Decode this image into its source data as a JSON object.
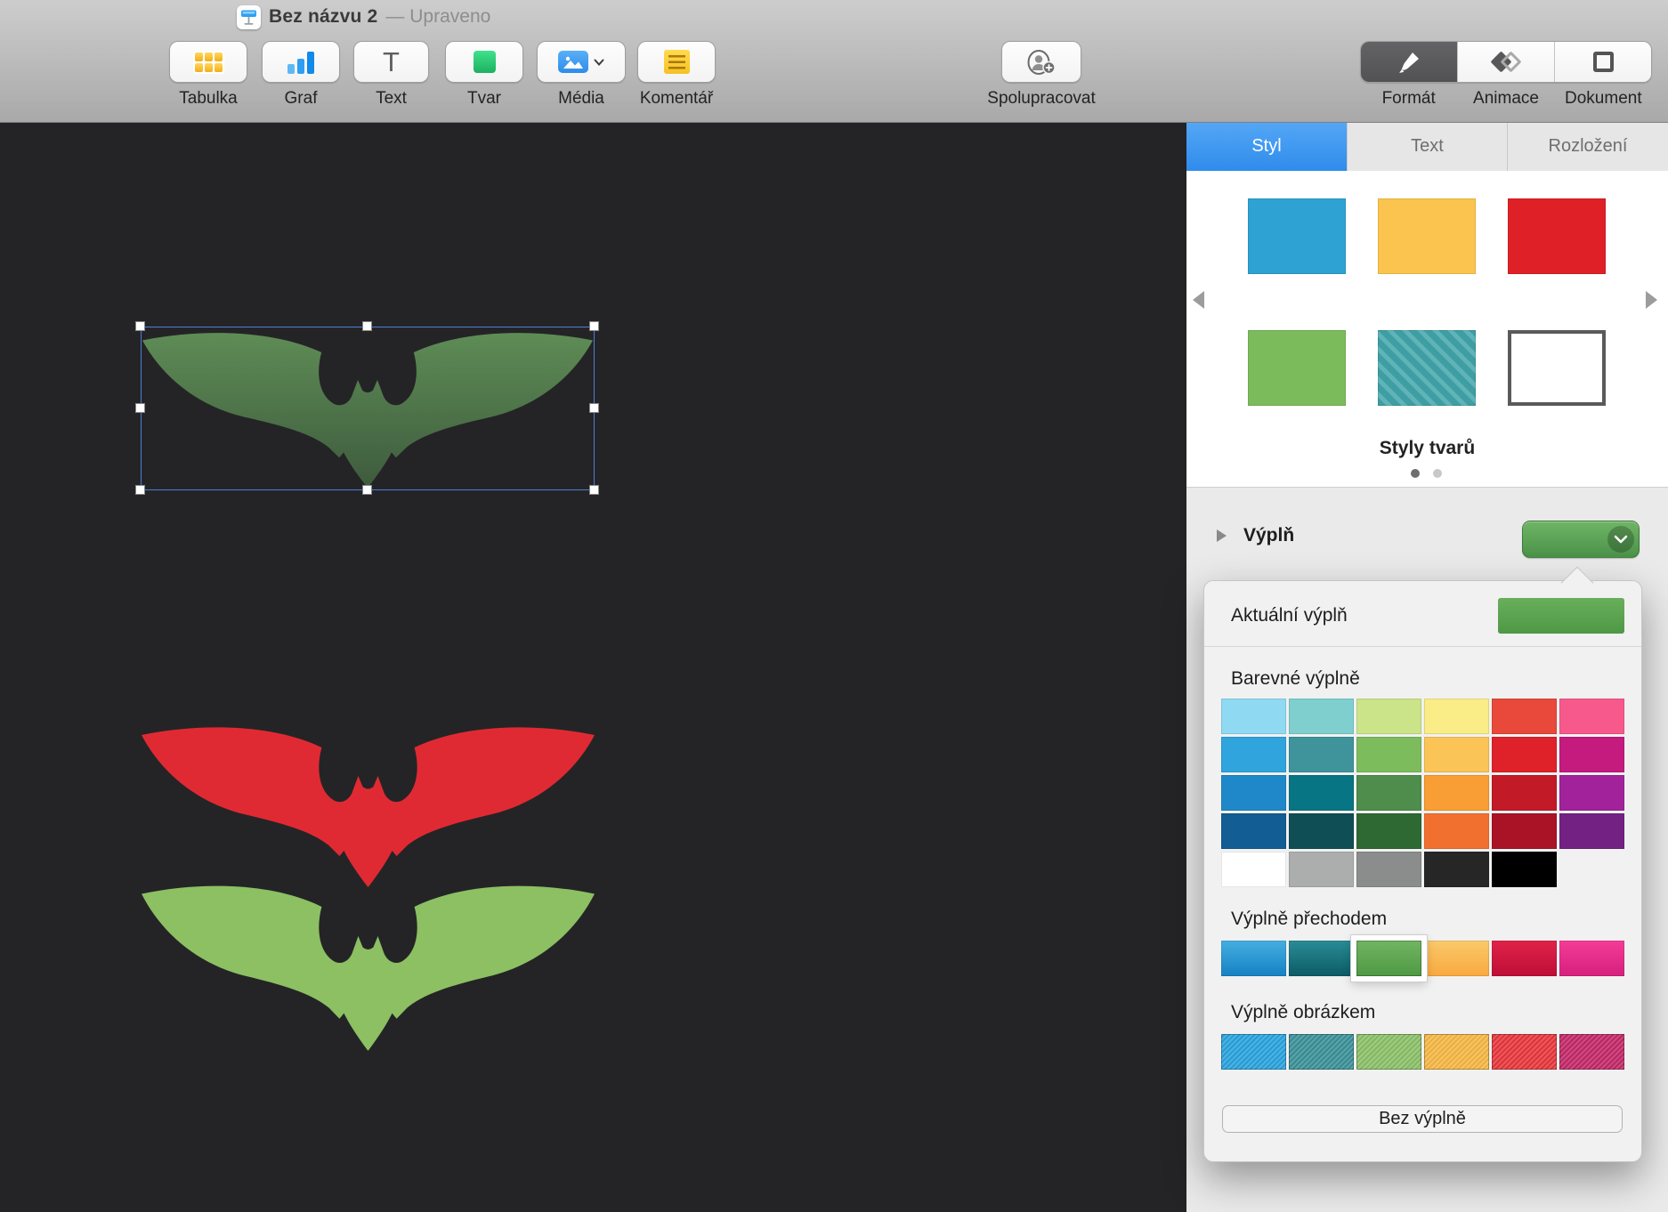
{
  "window": {
    "title": "Bez názvu 2",
    "separator": "—",
    "status": "Upraveno"
  },
  "toolbar": {
    "buttons": [
      {
        "label": "Tabulka"
      },
      {
        "label": "Graf"
      },
      {
        "label": "Text",
        "glyph": "T"
      },
      {
        "label": "Tvar"
      },
      {
        "label": "Média"
      },
      {
        "label": "Komentář"
      }
    ],
    "collaborate_label": "Spolupracovat",
    "view_switcher": [
      {
        "label": "Formát",
        "selected": true
      },
      {
        "label": "Animace",
        "selected": false
      },
      {
        "label": "Dokument",
        "selected": false
      }
    ]
  },
  "sidebar": {
    "tabs": [
      {
        "label": "Styl",
        "selected": true
      },
      {
        "label": "Text",
        "selected": false
      },
      {
        "label": "Rozložení",
        "selected": false
      }
    ],
    "shape_styles": {
      "title": "Styly tvarů",
      "row1": [
        "#2EA2D3",
        "#FBC44E",
        "#DF2127"
      ],
      "row2": [
        "#7CBB5C",
        "stripes",
        "outline"
      ],
      "page_count": 2,
      "active_page": 0
    },
    "fill": {
      "label": "Výplň",
      "button_gradient": "#6FB566|#4A9249"
    },
    "popover": {
      "current_fill_label": "Aktuální výplň",
      "current_fill": [
        "#69AF5B|#4E9845"
      ],
      "colors_label": "Barevné výplně",
      "gradients_label": "Výplně přechodem",
      "images_label": "Výplně obrázkem",
      "no_fill_label": "Bez výplně",
      "color_grid": [
        "#8FD9F2",
        "#7FCFCF",
        "#CCE489",
        "#FAEC87",
        "#E8493B",
        "#F7598C",
        "#2FA4DD",
        "#3F949C",
        "#7CBC5D",
        "#FBC457",
        "#DF2129",
        "#C51A7E",
        "#1F88C8",
        "#077583",
        "#4E8D4B",
        "#F99E34",
        "#C31A28",
        "#A2229C",
        "#125D94",
        "#0F4E55",
        "#2E6934",
        "#F2702F",
        "#A91325",
        "#732183",
        "#FFFFFF",
        "#ACAEAD",
        "#8B8D8C",
        "#262626",
        "#000000"
      ],
      "gradient_fills": [
        "#45AEE0|#1581C4",
        "#2A8C95|#0B5B66",
        "#71B562|#4F9944",
        "#FBC96B|#F9A93F",
        "#E02348|#BE0D37",
        "#F43C96|#D61F7E"
      ],
      "selected_gradient_index": 2,
      "image_fills": [
        "#29A3DE",
        "#3B9199",
        "#8BC168",
        "#F7B844",
        "#E8373C",
        "#C42868"
      ]
    }
  },
  "canvas": {
    "background": "#242426",
    "selected_bat": {
      "gradient_top": "#5E8C56",
      "gradient_bottom": "#3E5B3D"
    },
    "bats": [
      {
        "fill": "#E02A33"
      },
      {
        "fill": "#8CC063"
      }
    ]
  }
}
